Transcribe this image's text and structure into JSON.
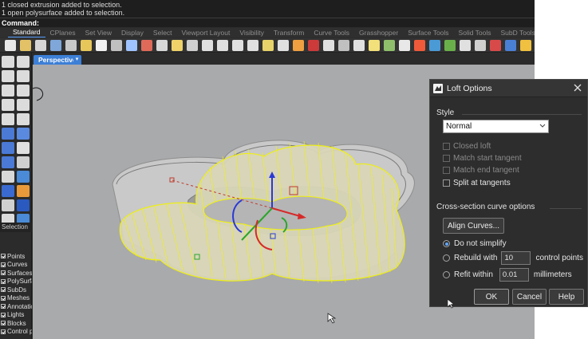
{
  "history": {
    "lines": [
      "1 closed extrusion added to selection.",
      "1 open polysurface added to selection."
    ]
  },
  "command": {
    "label": "Command:"
  },
  "tabs": [
    "Standard",
    "CPlanes",
    "Set View",
    "Display",
    "Select",
    "Viewport Layout",
    "Visibility",
    "Transform",
    "Curve Tools",
    "Grasshopper",
    "Surface Tools",
    "Solid Tools",
    "SubD Tools",
    "Mesh Tu"
  ],
  "toolbar_icon_colors": [
    "#e9e9e9",
    "#e3c267",
    "#d6d6d6",
    "#7fa7d9",
    "#c9c9c9",
    "#e8c75a",
    "#f1f1f1",
    "#c0c0c0",
    "#9fc3ff",
    "#e06a5a",
    "#d8d8d8",
    "#f0d26a",
    "#cfcfcf",
    "#e0e0e0",
    "#e0e0e0",
    "#e0e0e0",
    "#e0e0e0",
    "#e8d36a",
    "#e0e0e0",
    "#f0a040",
    "#cc3a3a",
    "#e0e0e0",
    "#c0c0c0",
    "#e0e0e0",
    "#f2e07a",
    "#8fbf6a",
    "#e8e8e8",
    "#ef5a3a",
    "#4a9ad6",
    "#6ab04a",
    "#e0e0e0",
    "#cfcfcf",
    "#d84a4a",
    "#4a7fd6",
    "#f0c040",
    "#b0b0b0",
    "#6aaf4a",
    "#3a6fd0",
    "#d03030"
  ],
  "left_tool_colors": [
    "#dcdcdc",
    "#dcdcdc",
    "#dcdcdc",
    "#dcdcdc",
    "#dcdcdc",
    "#dcdcdc",
    "#dcdcdc",
    "#dcdcdc",
    "#dcdcdc",
    "#dcdcdc",
    "#4a7ad6",
    "#5a8ae0",
    "#4a7ad6",
    "#e0e0e0",
    "#4a7ad6",
    "#d0d0d0",
    "#d8d8d8",
    "#4a8ad6",
    "#3a6ad0",
    "#e89a3a",
    "#d0d0d0",
    "#2a5ac0",
    "#dcdcdc",
    "#4a8ad6"
  ],
  "selection_filter": {
    "header": "Selection",
    "items": [
      {
        "label": "Points",
        "checked": true
      },
      {
        "label": "Curves",
        "checked": true
      },
      {
        "label": "Surfaces",
        "checked": true
      },
      {
        "label": "PolySurfaces",
        "checked": true
      },
      {
        "label": "SubDs",
        "checked": true
      },
      {
        "label": "Meshes",
        "checked": true
      },
      {
        "label": "Annotations",
        "checked": true
      },
      {
        "label": "Lights",
        "checked": true
      },
      {
        "label": "Blocks",
        "checked": true
      },
      {
        "label": "Control points",
        "checked": true
      }
    ]
  },
  "viewport": {
    "name": "Perspective"
  },
  "colors": {
    "viewport_bg": "#a9aaac",
    "curve_highlight": "#f2f20a",
    "accent": "#3c7fd6"
  },
  "loft_dialog": {
    "title": "Loft Options",
    "style_section": "Style",
    "style_value": "Normal",
    "options": [
      {
        "label": "Closed loft",
        "checked": false,
        "enabled": false
      },
      {
        "label": "Match start tangent",
        "checked": false,
        "enabled": false
      },
      {
        "label": "Match end tangent",
        "checked": false,
        "enabled": false
      },
      {
        "label": "Split at tangents",
        "checked": false,
        "enabled": true
      }
    ],
    "cross_section_section": "Cross-section curve options",
    "align_button": "Align Curves...",
    "simplify": [
      {
        "label": "Do not simplify",
        "selected": true
      },
      {
        "label": "Rebuild with",
        "selected": false,
        "value": "10",
        "suffix": "control points"
      },
      {
        "label": "Refit within",
        "selected": false,
        "value": "0.01",
        "suffix": "millimeters"
      }
    ],
    "ok_label": "OK",
    "cancel_label": "Cancel",
    "help_label": "Help"
  }
}
